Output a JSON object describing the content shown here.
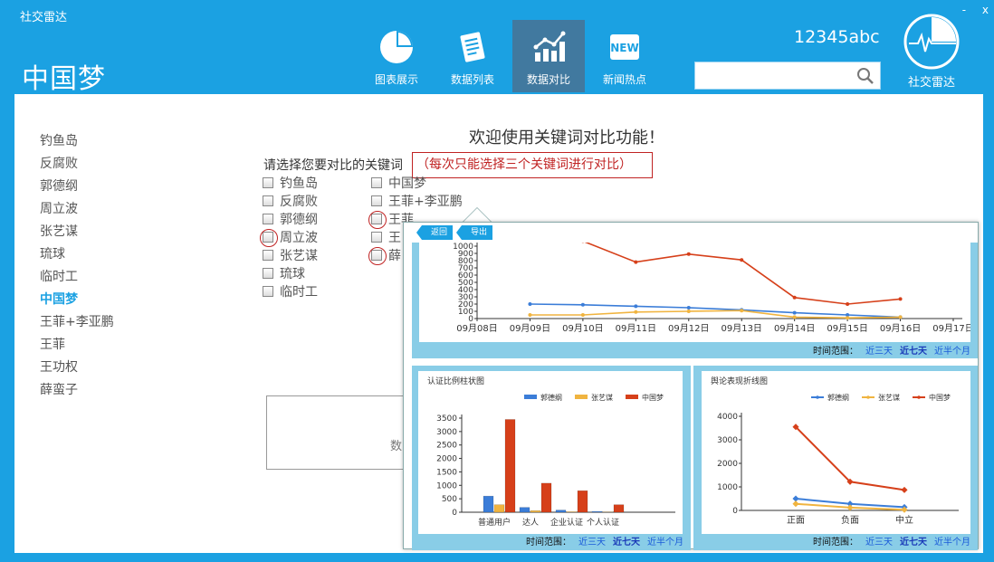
{
  "app": {
    "window_title": "社交雷达",
    "brand_title": "中国梦",
    "user_name": "12345abc",
    "logo_label": "社交雷达",
    "minimize": "-",
    "close": "x"
  },
  "nav": [
    {
      "label": "图表展示",
      "icon": "pie-chart-icon"
    },
    {
      "label": "数据列表",
      "icon": "document-list-icon"
    },
    {
      "label": "数据对比",
      "icon": "bar-trend-icon"
    },
    {
      "label": "新闻热点",
      "icon": "new-badge-icon"
    }
  ],
  "search": {
    "placeholder": "",
    "value": ""
  },
  "sidebar": {
    "items": [
      "钓鱼岛",
      "反腐败",
      "郭德纲",
      "周立波",
      "张艺谋",
      "琉球",
      "临时工",
      "中国梦",
      "王菲+李亚鹏",
      "王菲",
      "王功权",
      "薛蛮子"
    ],
    "active_index": 7
  },
  "main": {
    "welcome": "欢迎使用关键词对比功能！",
    "prompt": "请选择您要对比的关键词",
    "notice": "（每次只能选择三个关键词进行对比）",
    "col1": [
      "钓鱼岛",
      "反腐败",
      "郭德纲",
      "周立波",
      "张艺谋",
      "琉球",
      "临时工"
    ],
    "col2": [
      "中国梦",
      "王菲+李亚鹏",
      "王菲",
      "王",
      "薛"
    ],
    "data_box_text": "数"
  },
  "popup": {
    "back": "返回",
    "export": "导出",
    "range_label": "时间范围：",
    "ranges": [
      "近三天",
      "近七天",
      "近半个月"
    ],
    "bar_title": "认证比例柱状图",
    "line2_title": "舆论表现折线图",
    "legend": [
      "郭德纲",
      "张艺谋",
      "中国梦"
    ]
  },
  "colors": {
    "accent": "#1ba1e2",
    "series": [
      "#3b7dd8",
      "#f0b440",
      "#d6401a"
    ]
  },
  "chart_data": [
    {
      "type": "line",
      "x": [
        "09月08日",
        "09月09日",
        "09月10日",
        "09月11日",
        "09月12日",
        "09月13日",
        "09月14日",
        "09月15日",
        "09月16日",
        "09月17日"
      ],
      "ylim": [
        0,
        1000
      ],
      "yticks": [
        0,
        100,
        200,
        300,
        400,
        500,
        600,
        700,
        800,
        900,
        1000
      ],
      "series": [
        {
          "name": "郭德纲",
          "values": [
            null,
            200,
            190,
            170,
            150,
            120,
            80,
            50,
            20,
            null
          ]
        },
        {
          "name": "张艺谋",
          "values": [
            null,
            50,
            50,
            90,
            100,
            110,
            20,
            10,
            20,
            null
          ]
        },
        {
          "name": "中国梦",
          "values": [
            null,
            null,
            1070,
            780,
            890,
            810,
            290,
            200,
            270,
            null
          ]
        }
      ]
    },
    {
      "type": "bar",
      "title": "认证比例柱状图",
      "categories": [
        "普通用户",
        "达人",
        "企业认证",
        "个人认证"
      ],
      "ylim": [
        0,
        3500
      ],
      "yticks": [
        0,
        500,
        1000,
        1500,
        2000,
        2500,
        3000,
        3500
      ],
      "series": [
        {
          "name": "郭德纲",
          "values": [
            600,
            180,
            80,
            30
          ]
        },
        {
          "name": "张艺谋",
          "values": [
            280,
            60,
            20,
            10
          ]
        },
        {
          "name": "中国梦",
          "values": [
            3450,
            1080,
            800,
            280
          ]
        }
      ]
    },
    {
      "type": "line",
      "title": "舆论表现折线图",
      "categories": [
        "正面",
        "负面",
        "中立"
      ],
      "ylim": [
        0,
        4000
      ],
      "yticks": [
        0,
        1000,
        2000,
        3000,
        4000
      ],
      "series": [
        {
          "name": "郭德纲",
          "values": [
            500,
            280,
            140
          ]
        },
        {
          "name": "张艺谋",
          "values": [
            280,
            120,
            30
          ]
        },
        {
          "name": "中国梦",
          "values": [
            3550,
            1220,
            870
          ]
        }
      ]
    }
  ]
}
